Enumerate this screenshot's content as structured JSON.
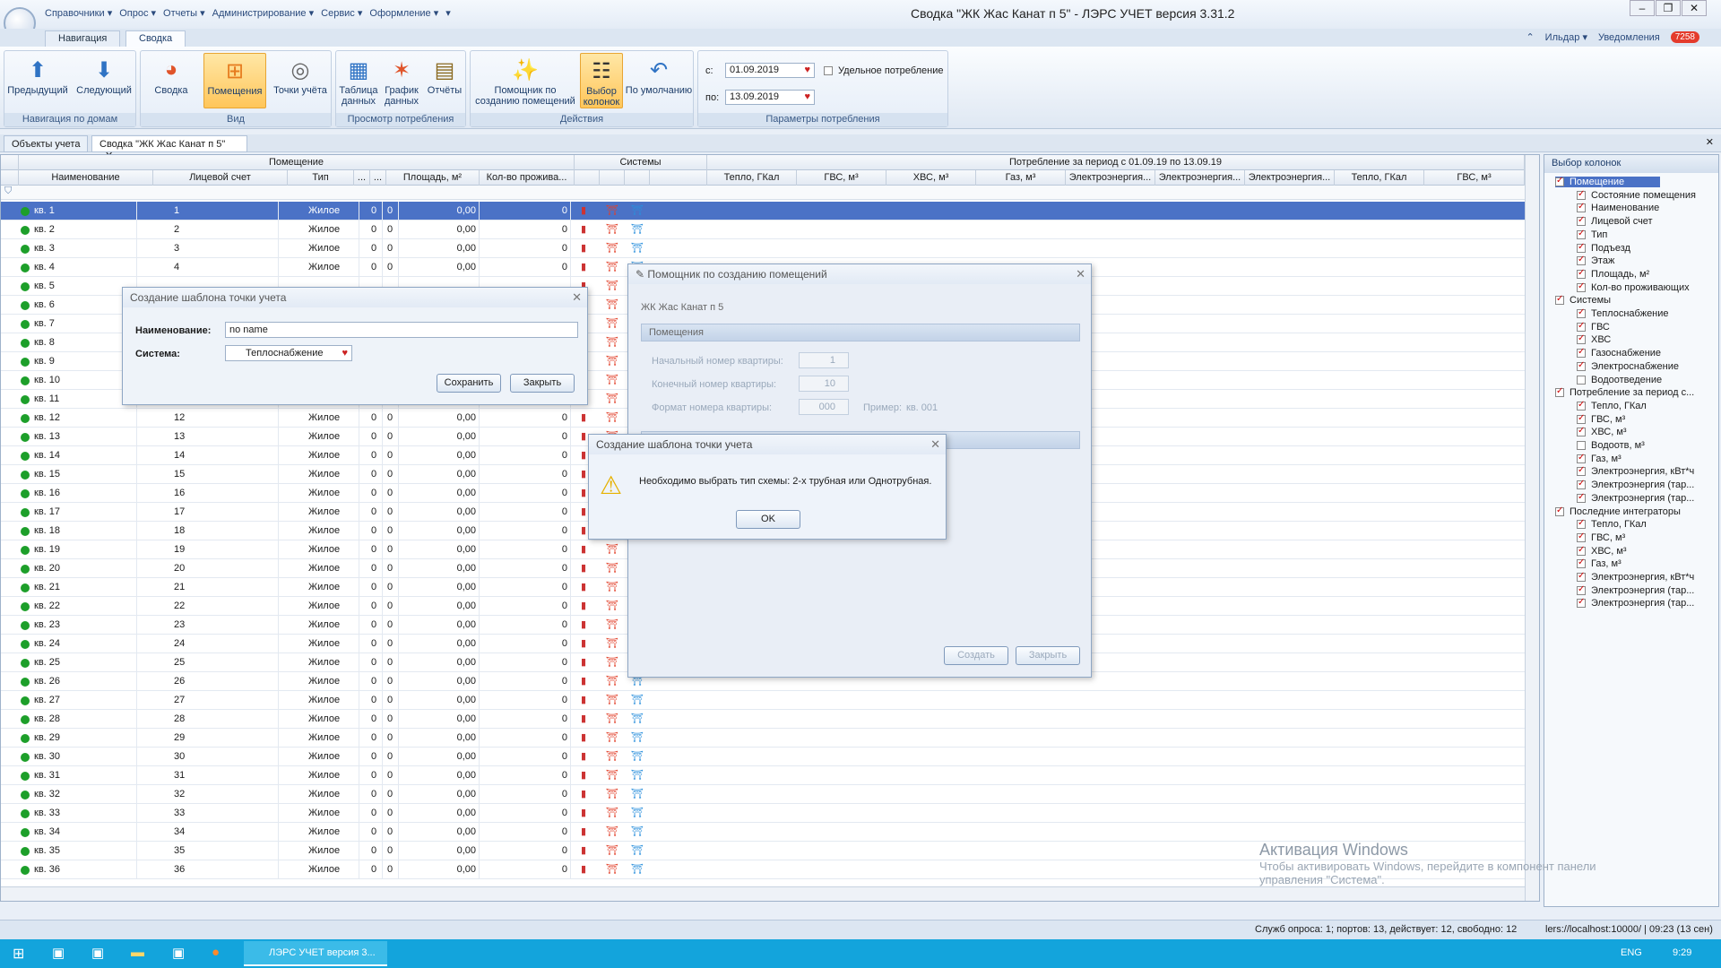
{
  "window": {
    "title": "Сводка \"ЖК Жас Канат п 5\" - ЛЭРС УЧЕТ версия 3.31.2",
    "min": "–",
    "max": "❐",
    "close": "✕"
  },
  "menu": [
    "Справочники ▾",
    "Опрос ▾",
    "Отчеты ▾",
    "Администрирование ▾",
    "Сервис ▾",
    "Оформление ▾",
    "▾"
  ],
  "ribbon_tabs": [
    "Навигация",
    "Сводка"
  ],
  "user": {
    "name": "Ильдар ▾",
    "notifications_label": "Уведомления",
    "notifications_count": "7258"
  },
  "ribbon": {
    "nav": {
      "label": "Навигация по домам",
      "prev": "Предыдущий",
      "next": "Следующий"
    },
    "view": {
      "label": "Вид",
      "svodka": "Сводка",
      "rooms": "Помещения",
      "points": "Точки учёта"
    },
    "consumption": {
      "label": "Просмотр потребления",
      "table": "Таблица данных",
      "chart": "График данных",
      "reports": "Отчёты"
    },
    "actions": {
      "label": "Действия",
      "wizard": "Помощник по созданию помещений",
      "choose_cols": "Выбор колонок",
      "default": "По умолчанию"
    },
    "params": {
      "label": "Параметры потребления",
      "from_label": "с:",
      "from": "01.09.2019",
      "to_label": "по:",
      "to": "13.09.2019",
      "specific": "Удельное потребление"
    }
  },
  "doc_tabs": [
    "Объекты учета",
    "Сводка \"ЖК Жас Канат п 5\""
  ],
  "grid": {
    "groups": {
      "rooms": "Помещение",
      "systems": "Системы",
      "consumption": "Потребление за период с 01.09.19 по 13.09.19"
    },
    "columns": [
      "Наименование",
      "Лицевой счет",
      "Тип",
      "...",
      "...",
      "Площадь, м²",
      "Кол-во прожива...",
      "Тепло, ГКал",
      "ГВС, м³",
      "ХВС, м³",
      "Газ, м³",
      "Электроэнергия...",
      "Электроэнергия...",
      "Электроэнергия...",
      "Тепло, ГКал",
      "ГВС, м³"
    ],
    "rows": [
      {
        "name": "кв. 1",
        "acc": "1",
        "type": "Жилое",
        "a": "0",
        "b": "0",
        "area": "0,00",
        "ppl": "0"
      },
      {
        "name": "кв. 2",
        "acc": "2",
        "type": "Жилое",
        "a": "0",
        "b": "0",
        "area": "0,00",
        "ppl": "0"
      },
      {
        "name": "кв. 3",
        "acc": "3",
        "type": "Жилое",
        "a": "0",
        "b": "0",
        "area": "0,00",
        "ppl": "0"
      },
      {
        "name": "кв. 4",
        "acc": "4",
        "type": "Жилое",
        "a": "0",
        "b": "0",
        "area": "0,00",
        "ppl": "0"
      },
      {
        "name": "кв. 5",
        "acc": "",
        "type": "",
        "a": "",
        "b": "",
        "area": "",
        "ppl": ""
      },
      {
        "name": "кв. 6",
        "acc": "",
        "type": "",
        "a": "",
        "b": "",
        "area": "",
        "ppl": ""
      },
      {
        "name": "кв. 7",
        "acc": "",
        "type": "",
        "a": "",
        "b": "",
        "area": "",
        "ppl": ""
      },
      {
        "name": "кв. 8",
        "acc": "",
        "type": "",
        "a": "",
        "b": "",
        "area": "",
        "ppl": ""
      },
      {
        "name": "кв. 9",
        "acc": "",
        "type": "",
        "a": "",
        "b": "",
        "area": "",
        "ppl": ""
      },
      {
        "name": "кв. 10",
        "acc": "",
        "type": "",
        "a": "",
        "b": "",
        "area": "",
        "ppl": ""
      },
      {
        "name": "кв. 11",
        "acc": "11",
        "type": "Жилое",
        "a": "0",
        "b": "0",
        "area": "0,00",
        "ppl": "0"
      },
      {
        "name": "кв. 12",
        "acc": "12",
        "type": "Жилое",
        "a": "0",
        "b": "0",
        "area": "0,00",
        "ppl": "0"
      },
      {
        "name": "кв. 13",
        "acc": "13",
        "type": "Жилое",
        "a": "0",
        "b": "0",
        "area": "0,00",
        "ppl": "0"
      },
      {
        "name": "кв. 14",
        "acc": "14",
        "type": "Жилое",
        "a": "0",
        "b": "0",
        "area": "0,00",
        "ppl": "0"
      },
      {
        "name": "кв. 15",
        "acc": "15",
        "type": "Жилое",
        "a": "0",
        "b": "0",
        "area": "0,00",
        "ppl": "0"
      },
      {
        "name": "кв. 16",
        "acc": "16",
        "type": "Жилое",
        "a": "0",
        "b": "0",
        "area": "0,00",
        "ppl": "0"
      },
      {
        "name": "кв. 17",
        "acc": "17",
        "type": "Жилое",
        "a": "0",
        "b": "0",
        "area": "0,00",
        "ppl": "0"
      },
      {
        "name": "кв. 18",
        "acc": "18",
        "type": "Жилое",
        "a": "0",
        "b": "0",
        "area": "0,00",
        "ppl": "0"
      },
      {
        "name": "кв. 19",
        "acc": "19",
        "type": "Жилое",
        "a": "0",
        "b": "0",
        "area": "0,00",
        "ppl": "0"
      },
      {
        "name": "кв. 20",
        "acc": "20",
        "type": "Жилое",
        "a": "0",
        "b": "0",
        "area": "0,00",
        "ppl": "0"
      },
      {
        "name": "кв. 21",
        "acc": "21",
        "type": "Жилое",
        "a": "0",
        "b": "0",
        "area": "0,00",
        "ppl": "0"
      },
      {
        "name": "кв. 22",
        "acc": "22",
        "type": "Жилое",
        "a": "0",
        "b": "0",
        "area": "0,00",
        "ppl": "0"
      },
      {
        "name": "кв. 23",
        "acc": "23",
        "type": "Жилое",
        "a": "0",
        "b": "0",
        "area": "0,00",
        "ppl": "0"
      },
      {
        "name": "кв. 24",
        "acc": "24",
        "type": "Жилое",
        "a": "0",
        "b": "0",
        "area": "0,00",
        "ppl": "0"
      },
      {
        "name": "кв. 25",
        "acc": "25",
        "type": "Жилое",
        "a": "0",
        "b": "0",
        "area": "0,00",
        "ppl": "0"
      },
      {
        "name": "кв. 26",
        "acc": "26",
        "type": "Жилое",
        "a": "0",
        "b": "0",
        "area": "0,00",
        "ppl": "0"
      },
      {
        "name": "кв. 27",
        "acc": "27",
        "type": "Жилое",
        "a": "0",
        "b": "0",
        "area": "0,00",
        "ppl": "0"
      },
      {
        "name": "кв. 28",
        "acc": "28",
        "type": "Жилое",
        "a": "0",
        "b": "0",
        "area": "0,00",
        "ppl": "0"
      },
      {
        "name": "кв. 29",
        "acc": "29",
        "type": "Жилое",
        "a": "0",
        "b": "0",
        "area": "0,00",
        "ppl": "0"
      },
      {
        "name": "кв. 30",
        "acc": "30",
        "type": "Жилое",
        "a": "0",
        "b": "0",
        "area": "0,00",
        "ppl": "0"
      },
      {
        "name": "кв. 31",
        "acc": "31",
        "type": "Жилое",
        "a": "0",
        "b": "0",
        "area": "0,00",
        "ppl": "0"
      },
      {
        "name": "кв. 32",
        "acc": "32",
        "type": "Жилое",
        "a": "0",
        "b": "0",
        "area": "0,00",
        "ppl": "0"
      },
      {
        "name": "кв. 33",
        "acc": "33",
        "type": "Жилое",
        "a": "0",
        "b": "0",
        "area": "0,00",
        "ppl": "0"
      },
      {
        "name": "кв. 34",
        "acc": "34",
        "type": "Жилое",
        "a": "0",
        "b": "0",
        "area": "0,00",
        "ppl": "0"
      },
      {
        "name": "кв. 35",
        "acc": "35",
        "type": "Жилое",
        "a": "0",
        "b": "0",
        "area": "0,00",
        "ppl": "0"
      },
      {
        "name": "кв. 36",
        "acc": "36",
        "type": "Жилое",
        "a": "0",
        "b": "0",
        "area": "0,00",
        "ppl": "0"
      }
    ]
  },
  "column_panel": {
    "title": "Выбор колонок",
    "items": [
      {
        "label": "Помещение",
        "level": 0,
        "on": true,
        "sel": true
      },
      {
        "label": "Состояние помещения",
        "level": 1,
        "on": true
      },
      {
        "label": "Наименование",
        "level": 1,
        "on": true
      },
      {
        "label": "Лицевой счет",
        "level": 1,
        "on": true
      },
      {
        "label": "Тип",
        "level": 1,
        "on": true
      },
      {
        "label": "Подъезд",
        "level": 1,
        "on": true
      },
      {
        "label": "Этаж",
        "level": 1,
        "on": true
      },
      {
        "label": "Площадь, м²",
        "level": 1,
        "on": true
      },
      {
        "label": "Кол-во проживающих",
        "level": 1,
        "on": true
      },
      {
        "label": "Системы",
        "level": 0,
        "on": true
      },
      {
        "label": "Теплоснабжение",
        "level": 1,
        "on": true
      },
      {
        "label": "ГВС",
        "level": 1,
        "on": true
      },
      {
        "label": "ХВС",
        "level": 1,
        "on": true
      },
      {
        "label": "Газоснабжение",
        "level": 1,
        "on": true
      },
      {
        "label": "Электроснабжение",
        "level": 1,
        "on": true
      },
      {
        "label": "Водоотведение",
        "level": 1,
        "on": false
      },
      {
        "label": "Потребление за период с...",
        "level": 0,
        "on": true
      },
      {
        "label": "Тепло, ГКал",
        "level": 1,
        "on": true
      },
      {
        "label": "ГВС, м³",
        "level": 1,
        "on": true
      },
      {
        "label": "ХВС, м³",
        "level": 1,
        "on": true
      },
      {
        "label": "Водоотв, м³",
        "level": 1,
        "on": false
      },
      {
        "label": "Газ, м³",
        "level": 1,
        "on": true
      },
      {
        "label": "Электроэнергия, кВт*ч",
        "level": 1,
        "on": true
      },
      {
        "label": "Электроэнергия (тар...",
        "level": 1,
        "on": true
      },
      {
        "label": "Электроэнергия (тар...",
        "level": 1,
        "on": true
      },
      {
        "label": "Последние интеграторы",
        "level": 0,
        "on": true
      },
      {
        "label": "Тепло, ГКал",
        "level": 1,
        "on": true
      },
      {
        "label": "ГВС, м³",
        "level": 1,
        "on": true
      },
      {
        "label": "ХВС, м³",
        "level": 1,
        "on": true
      },
      {
        "label": "Газ, м³",
        "level": 1,
        "on": true
      },
      {
        "label": "Электроэнергия, кВт*ч",
        "level": 1,
        "on": true
      },
      {
        "label": "Электроэнергия (тар...",
        "level": 1,
        "on": true
      },
      {
        "label": "Электроэнергия (тар...",
        "level": 1,
        "on": true
      }
    ]
  },
  "dialog_template": {
    "title": "Создание шаблона точки учета",
    "name_label": "Наименование:",
    "name_value": "no name",
    "system_label": "Система:",
    "system_value": "Теплоснабжение",
    "save": "Сохранить",
    "close": "Закрыть"
  },
  "dialog_wizard": {
    "title": "Помощник по созданию помещений",
    "building": "ЖК Жас Канат п 5",
    "section": "Помещения",
    "start_label": "Начальный номер квартиры:",
    "start_value": "1",
    "end_label": "Конечный номер квартиры:",
    "end_value": "10",
    "format_label": "Формат номера квартиры:",
    "format_value": "000",
    "example_label": "Пример:",
    "example_value": "кв. 001",
    "create": "Создать",
    "close": "Закрыть"
  },
  "dialog_alert": {
    "title": "Создание шаблона точки учета",
    "message": "Необходимо выбрать тип схемы: 2-х трубная или Однотрубная.",
    "ok": "OK"
  },
  "status": {
    "service": "Служб опроса: 1; портов: 13, действует: 12, свободно: 12",
    "server": "lers://localhost:10000/ | 09:23 (13 сен)"
  },
  "watermark": {
    "title": "Активация Windows",
    "line1": "Чтобы активировать Windows, перейдите в компонент панели",
    "line2": "управления \"Система\"."
  },
  "taskbar": {
    "app": "ЛЭРС УЧЕТ версия 3...",
    "lang": "ENG",
    "time": "9:29"
  }
}
